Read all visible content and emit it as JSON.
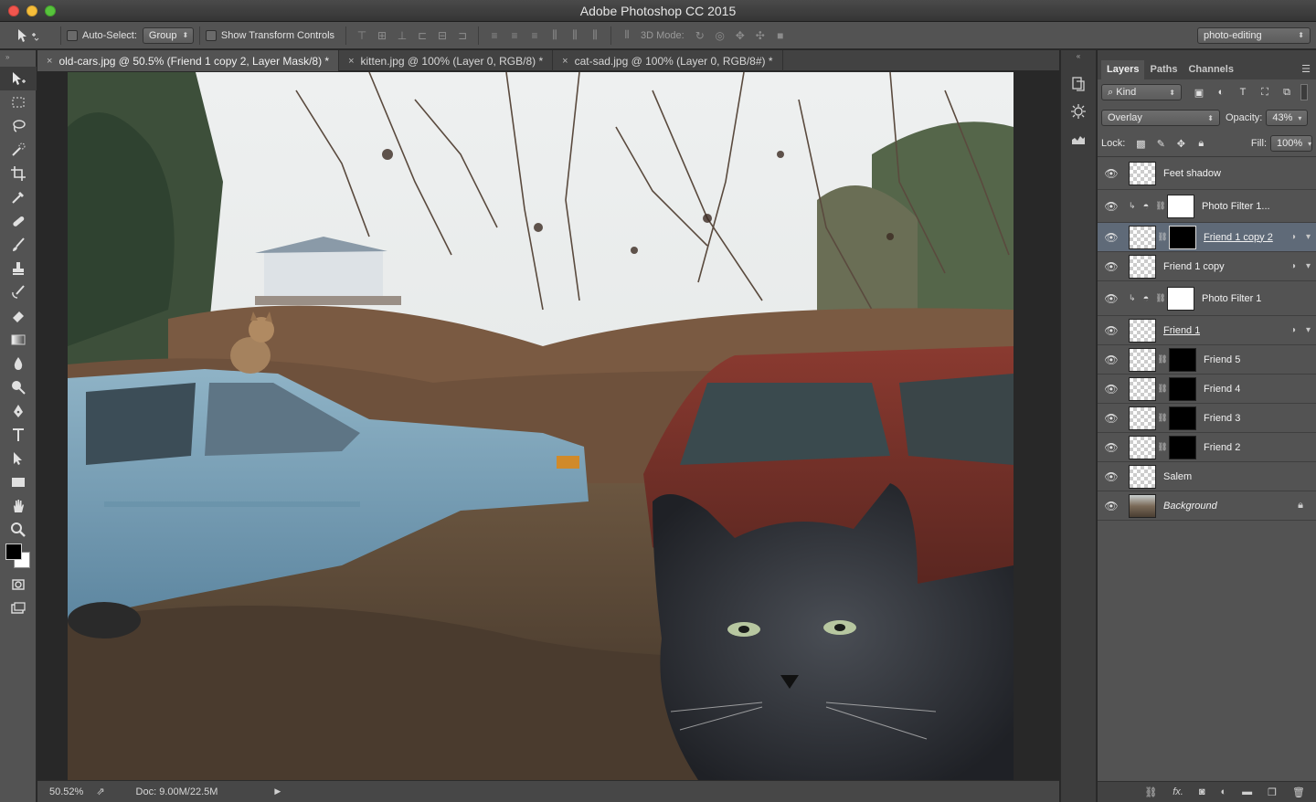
{
  "window": {
    "title": "Adobe Photoshop CC 2015"
  },
  "options_bar": {
    "auto_select_label": "Auto-Select:",
    "auto_select_value": "Group",
    "show_transform_label": "Show Transform Controls",
    "mode_3d_label": "3D Mode:",
    "workspace": "photo-editing"
  },
  "tabs": [
    {
      "close": "×",
      "label": "old-cars.jpg @ 50.5% (Friend 1 copy 2, Layer Mask/8) *"
    },
    {
      "close": "×",
      "label": "kitten.jpg @ 100% (Layer 0, RGB/8) *"
    },
    {
      "close": "×",
      "label": "cat-sad.jpg @ 100% (Layer 0, RGB/8#) *"
    }
  ],
  "status_bar": {
    "zoom": "50.52%",
    "doc": "Doc: 9.00M/22.5M"
  },
  "layers_panel": {
    "tabs": [
      "Layers",
      "Paths",
      "Channels"
    ],
    "filter_kind": "Kind",
    "blend_mode": "Overlay",
    "opacity_label": "Opacity:",
    "opacity": "43%",
    "lock_label": "Lock:",
    "fill_label": "Fill:",
    "fill": "100%",
    "layers": [
      {
        "name": "Feet shadow"
      },
      {
        "name": "Photo Filter 1..."
      },
      {
        "name": "Friend 1 copy 2"
      },
      {
        "name": "Friend 1 copy"
      },
      {
        "name": "Photo Filter 1"
      },
      {
        "name": "Friend 1"
      },
      {
        "name": "Friend 5"
      },
      {
        "name": "Friend 4"
      },
      {
        "name": "Friend 3"
      },
      {
        "name": "Friend 2"
      },
      {
        "name": "Salem"
      },
      {
        "name": "Background"
      }
    ],
    "footer_icons": [
      "link-icon",
      "fx-icon",
      "mask-icon",
      "adjustment-icon",
      "folder-icon",
      "new-layer-icon",
      "trash-icon"
    ]
  },
  "colors": {
    "selected_layer": "#5f6a78",
    "foreground": "#000000",
    "background": "#ffffff"
  }
}
